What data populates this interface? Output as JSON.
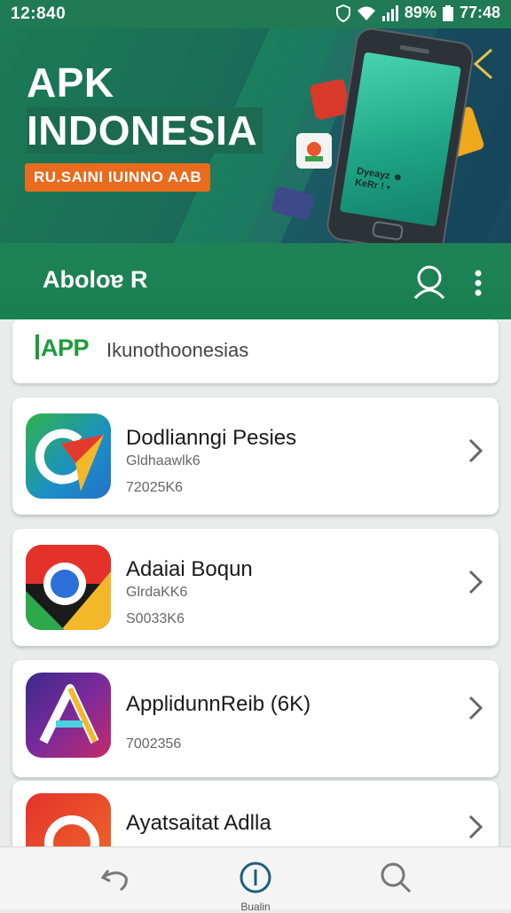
{
  "status_bar": {
    "time_left": "12:840",
    "battery_text": "89%",
    "time_right": "77:48"
  },
  "banner": {
    "title_line1": "APK",
    "title_line2": "INDONESIA",
    "tagline": "RU.SAINI IUINNO AAB",
    "phone_screen_text": "Dyeayz ☻\nKeRr ! •"
  },
  "app_bar": {
    "title": "Aboloɐ R"
  },
  "brand_bar": {
    "logo": "APP",
    "text": "Ikunothoonesias"
  },
  "apps": [
    {
      "name": "Dodlianngi Pesies",
      "developer": "Gldhaawlk6",
      "size": "72025K6"
    },
    {
      "name": "Adaiai Boqun",
      "developer": "GlrdaKK6",
      "size": "S0033K6"
    },
    {
      "name": "ApplidunnReib (6K)",
      "developer": "",
      "size": "7002356"
    },
    {
      "name": "Ayatsaitat Adlla",
      "developer": "",
      "size": ""
    }
  ],
  "bottom_nav": {
    "center_label": "Bualin"
  },
  "colors": {
    "primary": "#1f8257",
    "accent": "#e86b1e",
    "brand_green": "#1f9a3a"
  }
}
